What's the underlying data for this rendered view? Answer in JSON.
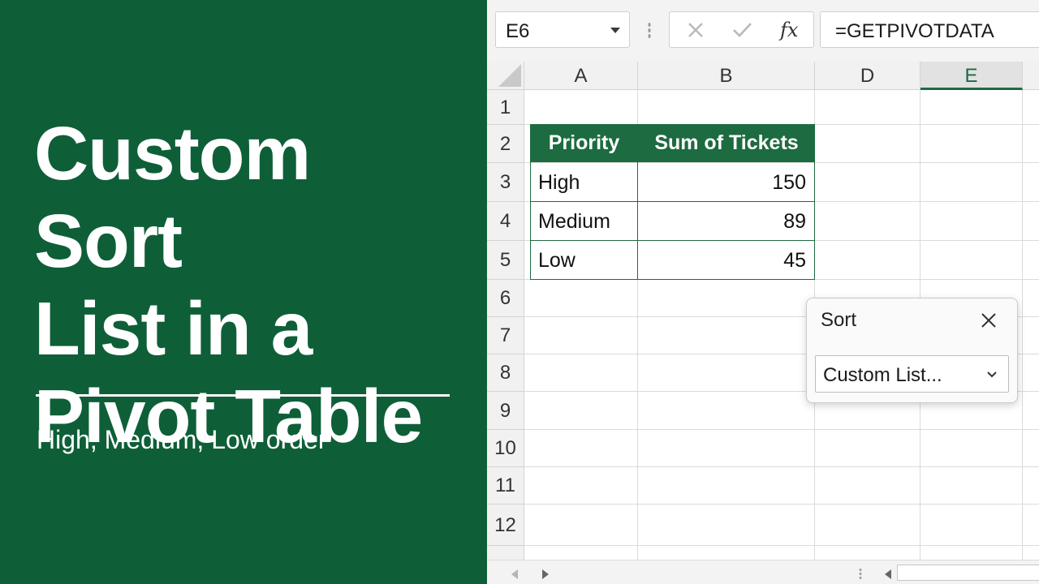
{
  "panel": {
    "title_lines": [
      "Custom Sort",
      "List in a",
      "Pivot Table"
    ],
    "subtitle": "High, Medium, Low order",
    "bg_color": "#0e5f38"
  },
  "formula_bar": {
    "name_box": "E6",
    "cancel_icon": "x-icon",
    "enter_icon": "check-icon",
    "fx_label": "fx",
    "formula": "=GETPIVOTDATA"
  },
  "grid": {
    "columns": [
      "A",
      "B",
      "D",
      "E"
    ],
    "active_column": "E",
    "rows": [
      "1",
      "2",
      "3",
      "4",
      "5",
      "6",
      "7",
      "8",
      "9",
      "10",
      "11",
      "12"
    ]
  },
  "pivot": {
    "headers": [
      "Priority",
      "Sum of Tickets"
    ],
    "rows": [
      {
        "label": "High",
        "value": "150"
      },
      {
        "label": "Medium",
        "value": "89"
      },
      {
        "label": "Low",
        "value": "45"
      }
    ],
    "accent": "#1d6b40"
  },
  "sort_dialog": {
    "title": "Sort",
    "close_icon": "close-icon",
    "selected": "Custom List..."
  }
}
